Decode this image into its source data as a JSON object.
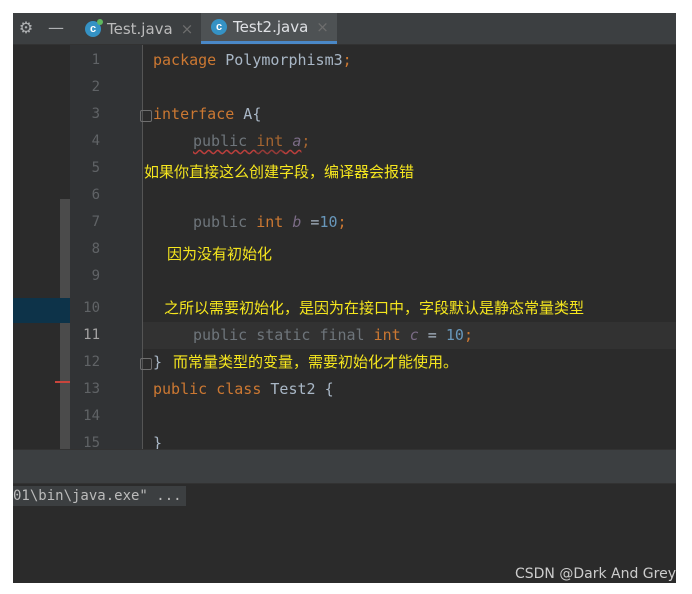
{
  "toolbar": {
    "settings_icon": "gear-icon",
    "hide_icon": "minus-icon"
  },
  "tabs": [
    {
      "label": "Test.java",
      "close": "×",
      "icon": "java-class-icon",
      "active": false
    },
    {
      "label": "Test2.java",
      "close": "×",
      "icon": "java-class-icon",
      "active": true
    }
  ],
  "editor": {
    "current_line": 11,
    "line_numbers": [
      "1",
      "2",
      "3",
      "4",
      "5",
      "6",
      "7",
      "8",
      "9",
      "10",
      "11",
      "12",
      "13",
      "14",
      "15"
    ],
    "code": {
      "l1": {
        "kw": "package",
        "rest": " Polymorphism3",
        "semi": ";"
      },
      "l3": {
        "kw": "interface",
        "rest": " A{"
      },
      "l4": {
        "kw1": "public",
        "kw2": "int",
        "field": "a",
        "semi": ";"
      },
      "l7": {
        "kw1": "public",
        "kw2": "int",
        "field": "b",
        "op": " =",
        "num": "10",
        "semi": ";"
      },
      "l11": {
        "kw1": "public",
        "kw2": "static",
        "kw3": "final",
        "kw4": "int",
        "field": "c",
        "op": " = ",
        "num": "10",
        "semi": ";"
      },
      "l12": {
        "text": "}"
      },
      "l13": {
        "kw1": "public",
        "kw2": "class",
        "rest": " Test2 {"
      },
      "l15": {
        "text": "}"
      }
    },
    "annotations": {
      "note1": "如果你直接这么创建字段，编译器会报错",
      "note2": "因为没有初始化",
      "note3": "之所以需要初始化，是因为在接口中，字段默认是静态常量类型",
      "note4": "而常量类型的变量，需要初始化才能使用。"
    }
  },
  "console": {
    "text": "01\\bin\\java.exe\" ..."
  },
  "watermark": "CSDN @Dark And Grey",
  "colors": {
    "annotation": "#f5e61e",
    "keyword": "#cc7832",
    "number": "#6897bb",
    "field": "#9876aa",
    "tab_accent": "#4a88c7"
  }
}
